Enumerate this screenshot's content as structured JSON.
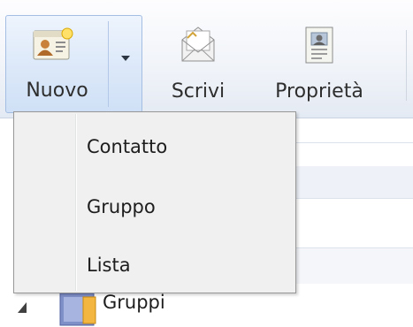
{
  "toolbar": {
    "new_button": {
      "label": "Nuovo",
      "icon": "contact-card-icon"
    },
    "compose_button": {
      "label": "Scrivi",
      "icon": "envelope-icon"
    },
    "properties_button": {
      "label": "Proprietà",
      "icon": "properties-card-icon"
    }
  },
  "dropdown_menu": {
    "items": [
      {
        "label": "Contatto"
      },
      {
        "label": "Gruppo"
      },
      {
        "label": "Lista"
      }
    ]
  },
  "tree": {
    "node": {
      "label": "Gruppi",
      "icon": "group-folder-icon",
      "expander": "collapse-triangle-icon"
    }
  },
  "colors": {
    "toolbar_bg": "#eef2f8",
    "split_button_hover": "#dde9f9",
    "menu_bg": "#f0f0f0",
    "menu_border": "#979797"
  }
}
